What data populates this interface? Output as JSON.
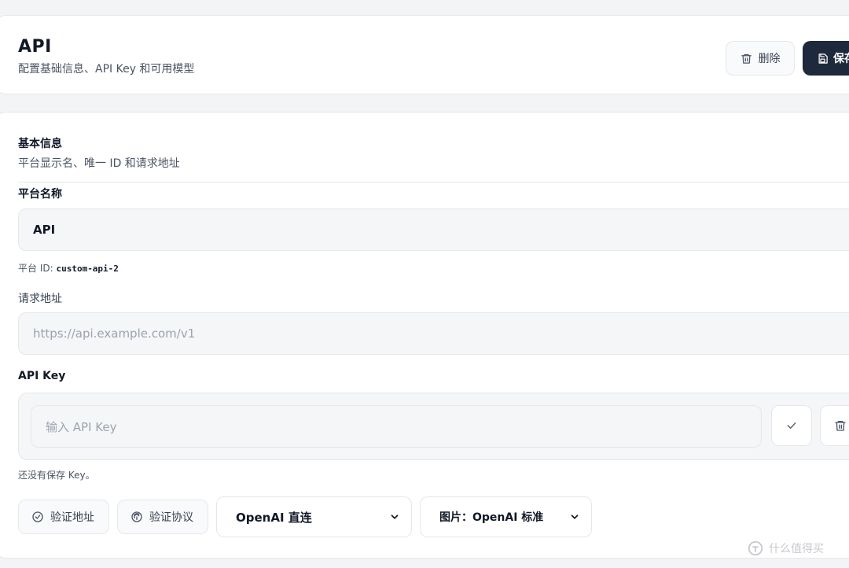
{
  "header": {
    "title": "API",
    "subtitle": "配置基础信息、API Key 和可用模型",
    "delete_label": "删除",
    "save_label": "保存"
  },
  "basic": {
    "section_title": "基本信息",
    "section_desc": "平台显示名、唯一 ID 和请求地址",
    "name_label": "平台名称",
    "name_value": "API",
    "id_prefix": "平台 ID: ",
    "id_value": "custom-api-2",
    "url_label": "请求地址",
    "url_placeholder": "https://api.example.com/v1",
    "key_label": "API Key",
    "key_placeholder": "输入 API Key",
    "key_hint": "还没有保存 Key。"
  },
  "actions": {
    "verify_url": "验证地址",
    "verify_protocol": "验证协议",
    "protocol_select": "OpenAI 直连",
    "image_select": "图片：OpenAI 标准"
  },
  "watermark": "什么值得买",
  "colors": {
    "primary": "#1e293b",
    "border": "#e5e7eb",
    "field_bg": "#f5f6f8"
  }
}
